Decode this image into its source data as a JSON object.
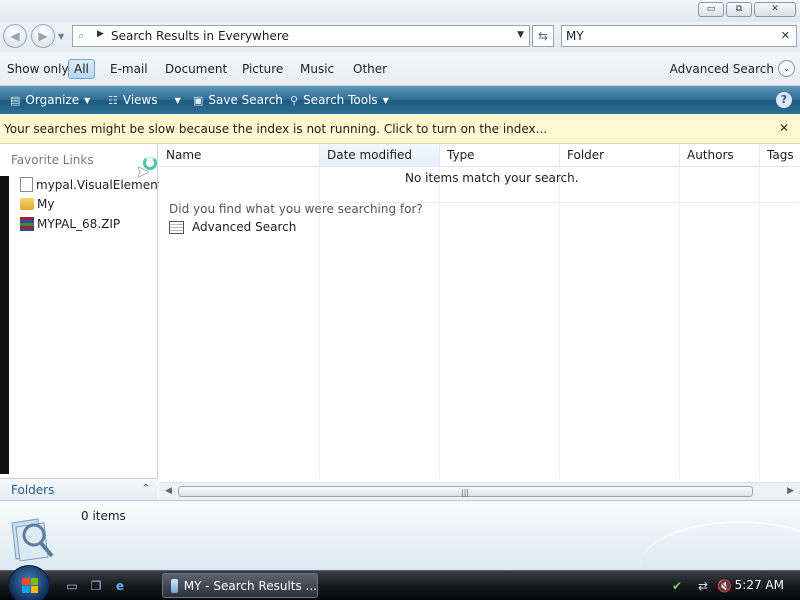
{
  "window": {
    "minimize_glyph": "▭",
    "maximize_glyph": "⧉",
    "close_glyph": "✕"
  },
  "address": {
    "back_glyph": "◀",
    "forward_glyph": "▶",
    "breadcrumb_arrow": "▶",
    "path_text": "Search Results in Everywhere",
    "dropdown_glyph": "▼",
    "refresh_glyph": "⇆"
  },
  "search": {
    "value": "MY",
    "clear_glyph": "✕"
  },
  "show_only": {
    "label": "Show only:",
    "filters": [
      "All",
      "E-mail",
      "Document",
      "Picture",
      "Music",
      "Other"
    ],
    "active": "All",
    "advanced_search_label": "Advanced Search",
    "chevron": "⌄"
  },
  "command_bar": {
    "organize": "Organize",
    "views": "Views",
    "save_search": "Save Search",
    "search_tools": "Search Tools",
    "dropdown_glyph": "▼",
    "help_glyph": "?"
  },
  "info_bar": {
    "message": "Your searches might be slow because the index is not running.  Click to turn on the index...",
    "close_glyph": "✕"
  },
  "nav_pane": {
    "favorite_links_title": "Favorite Links",
    "items": [
      {
        "label": "mypal.VisualElementsI",
        "icon": "file-icon"
      },
      {
        "label": "My",
        "icon": "folder-icon"
      },
      {
        "label": "MYPAL_68.ZIP",
        "icon": "zip-archive-icon"
      }
    ],
    "folders_label": "Folders",
    "folders_chevron": "⌃"
  },
  "content": {
    "columns": [
      "Name",
      "Date modified",
      "Type",
      "Folder",
      "Authors",
      "Tags"
    ],
    "sorted_column": "Date modified",
    "empty_message": "No items match your search.",
    "prompt": "Did you find what you were searching for?",
    "advanced_search_link": "Advanced Search"
  },
  "scrollbar": {
    "left_glyph": "◀",
    "right_glyph": "▶",
    "grip_glyph": "|||"
  },
  "details_pane": {
    "count": "0 items"
  },
  "taskbar": {
    "task_label": "MY - Search Results ...",
    "clock": "5:27 AM",
    "quicklaunch": [
      "show-desktop-icon",
      "switch-windows-icon",
      "internet-explorer-icon"
    ],
    "tray_glyphs": [
      "✔",
      "⇄",
      "🔇"
    ]
  },
  "colors": {
    "command_bar": "#2f6d95",
    "info_bar": "#fff8d0",
    "folders_text": "#2a5c8f",
    "taskbar": "#17191d"
  }
}
